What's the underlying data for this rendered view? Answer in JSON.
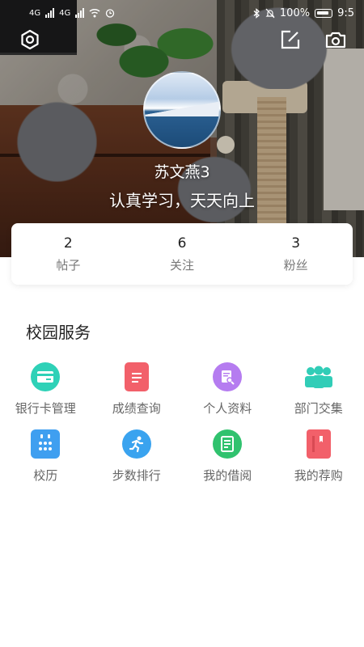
{
  "status_bar": {
    "network_left": "4G",
    "network_right": "4G",
    "battery_text": "100%",
    "time": "9:5"
  },
  "profile": {
    "name": "苏文燕3",
    "motto": "认真学习，天天向上"
  },
  "stats": [
    {
      "value": "2",
      "label": "帖子"
    },
    {
      "value": "6",
      "label": "关注"
    },
    {
      "value": "3",
      "label": "粉丝"
    }
  ],
  "services": {
    "title": "校园服务",
    "items": [
      {
        "label": "银行卡管理",
        "icon": "bank-card-icon",
        "color": "#2ed1b7"
      },
      {
        "label": "成绩查询",
        "icon": "grade-report-icon",
        "color": "#f2606a"
      },
      {
        "label": "个人资料",
        "icon": "profile-document-icon",
        "color": "#b57cf0"
      },
      {
        "label": "部门交集",
        "icon": "department-people-icon",
        "color": "#31cdb7"
      },
      {
        "label": "校历",
        "icon": "calendar-icon",
        "color": "#3f9ff0"
      },
      {
        "label": "步数排行",
        "icon": "running-person-icon",
        "color": "#3aa3ef"
      },
      {
        "label": "我的借阅",
        "icon": "book-borrow-icon",
        "color": "#30c26e"
      },
      {
        "label": "我的荐购",
        "icon": "book-recommend-icon",
        "color": "#f2606a"
      }
    ]
  }
}
